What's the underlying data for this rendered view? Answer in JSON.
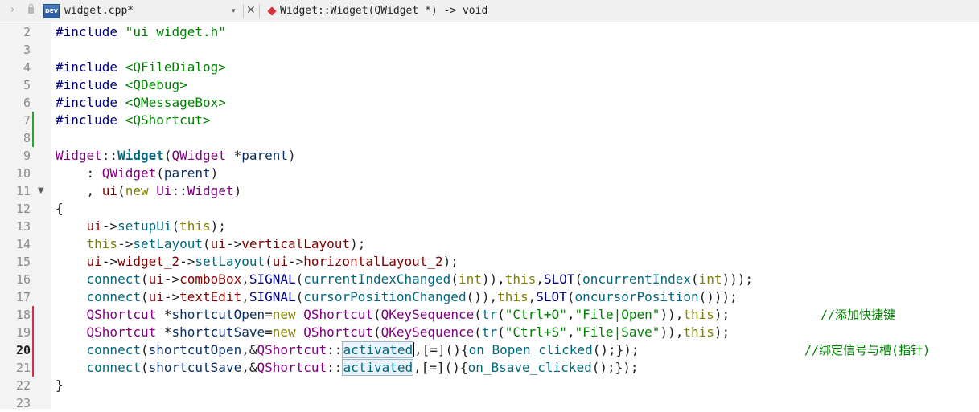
{
  "tabbar": {
    "back_arrow": "›",
    "file_icon_text": "DEV",
    "file_name": "widget.cpp*",
    "dropdown_arrow": "▾",
    "close": "✕",
    "symbol": "Widget::Widget(QWidget *) -> void"
  },
  "colors": {
    "modified_marker": "#d4313c",
    "saved_marker": "#2fa02f",
    "comment": "#008000"
  },
  "editor": {
    "current_line": 20,
    "lines": [
      {
        "n": "2",
        "marker": "",
        "fold": false,
        "tokens": [
          {
            "t": "#include",
            "c": "dir"
          },
          {
            "t": " ",
            "c": ""
          },
          {
            "t": "\"ui_widget.h\"",
            "c": "str"
          }
        ],
        "comment": ""
      },
      {
        "n": "3",
        "marker": "",
        "fold": false,
        "tokens": [],
        "comment": ""
      },
      {
        "n": "4",
        "marker": "",
        "fold": false,
        "tokens": [
          {
            "t": "#include",
            "c": "dir"
          },
          {
            "t": " ",
            "c": ""
          },
          {
            "t": "<QFileDialog>",
            "c": "inc"
          }
        ],
        "comment": ""
      },
      {
        "n": "5",
        "marker": "",
        "fold": false,
        "tokens": [
          {
            "t": "#include",
            "c": "dir"
          },
          {
            "t": " ",
            "c": ""
          },
          {
            "t": "<QDebug>",
            "c": "inc"
          }
        ],
        "comment": ""
      },
      {
        "n": "6",
        "marker": "",
        "fold": false,
        "tokens": [
          {
            "t": "#include",
            "c": "dir"
          },
          {
            "t": " ",
            "c": ""
          },
          {
            "t": "<QMessageBox>",
            "c": "inc"
          }
        ],
        "comment": ""
      },
      {
        "n": "7",
        "marker": "saved",
        "fold": false,
        "tokens": [
          {
            "t": "#include",
            "c": "dir"
          },
          {
            "t": " ",
            "c": ""
          },
          {
            "t": "<QShortcut>",
            "c": "inc"
          }
        ],
        "comment": ""
      },
      {
        "n": "8",
        "marker": "saved",
        "fold": false,
        "tokens": [],
        "comment": ""
      },
      {
        "n": "9",
        "marker": "",
        "fold": false,
        "tokens": [
          {
            "t": "Widget",
            "c": "cls"
          },
          {
            "t": "::",
            "c": ""
          },
          {
            "t": "Widget",
            "c": "fnb"
          },
          {
            "t": "(",
            "c": ""
          },
          {
            "t": "QWidget",
            "c": "cls"
          },
          {
            "t": " *",
            "c": ""
          },
          {
            "t": "parent",
            "c": "var"
          },
          {
            "t": ")",
            "c": ""
          }
        ],
        "comment": ""
      },
      {
        "n": "10",
        "marker": "",
        "fold": false,
        "tokens": [
          {
            "t": "    : ",
            "c": ""
          },
          {
            "t": "QWidget",
            "c": "cls"
          },
          {
            "t": "(",
            "c": ""
          },
          {
            "t": "parent",
            "c": "var"
          },
          {
            "t": ")",
            "c": ""
          }
        ],
        "comment": ""
      },
      {
        "n": "11",
        "marker": "",
        "fold": true,
        "tokens": [
          {
            "t": "    , ",
            "c": ""
          },
          {
            "t": "ui",
            "c": "mem"
          },
          {
            "t": "(",
            "c": ""
          },
          {
            "t": "new",
            "c": "kw"
          },
          {
            "t": " ",
            "c": ""
          },
          {
            "t": "Ui",
            "c": "cls"
          },
          {
            "t": "::",
            "c": ""
          },
          {
            "t": "Widget",
            "c": "cls"
          },
          {
            "t": ")",
            "c": ""
          }
        ],
        "comment": ""
      },
      {
        "n": "12",
        "marker": "",
        "fold": false,
        "tokens": [
          {
            "t": "{",
            "c": ""
          }
        ],
        "comment": ""
      },
      {
        "n": "13",
        "marker": "",
        "fold": false,
        "tokens": [
          {
            "t": "    ",
            "c": ""
          },
          {
            "t": "ui",
            "c": "mem"
          },
          {
            "t": "->",
            "c": ""
          },
          {
            "t": "setupUi",
            "c": "fn"
          },
          {
            "t": "(",
            "c": ""
          },
          {
            "t": "this",
            "c": "kw"
          },
          {
            "t": ");",
            "c": ""
          }
        ],
        "comment": ""
      },
      {
        "n": "14",
        "marker": "",
        "fold": false,
        "tokens": [
          {
            "t": "    ",
            "c": ""
          },
          {
            "t": "this",
            "c": "kw"
          },
          {
            "t": "->",
            "c": ""
          },
          {
            "t": "setLayout",
            "c": "fn"
          },
          {
            "t": "(",
            "c": ""
          },
          {
            "t": "ui",
            "c": "mem"
          },
          {
            "t": "->",
            "c": ""
          },
          {
            "t": "verticalLayout",
            "c": "mem"
          },
          {
            "t": ");",
            "c": ""
          }
        ],
        "comment": ""
      },
      {
        "n": "15",
        "marker": "",
        "fold": false,
        "tokens": [
          {
            "t": "    ",
            "c": ""
          },
          {
            "t": "ui",
            "c": "mem"
          },
          {
            "t": "->",
            "c": ""
          },
          {
            "t": "widget_2",
            "c": "mem"
          },
          {
            "t": "->",
            "c": ""
          },
          {
            "t": "setLayout",
            "c": "fn"
          },
          {
            "t": "(",
            "c": ""
          },
          {
            "t": "ui",
            "c": "mem"
          },
          {
            "t": "->",
            "c": ""
          },
          {
            "t": "horizontalLayout_2",
            "c": "mem"
          },
          {
            "t": ");",
            "c": ""
          }
        ],
        "comment": ""
      },
      {
        "n": "16",
        "marker": "",
        "fold": false,
        "tokens": [
          {
            "t": "    ",
            "c": ""
          },
          {
            "t": "connect",
            "c": "fn"
          },
          {
            "t": "(",
            "c": ""
          },
          {
            "t": "ui",
            "c": "mem"
          },
          {
            "t": "->",
            "c": ""
          },
          {
            "t": "comboBox",
            "c": "mem"
          },
          {
            "t": ",",
            "c": ""
          },
          {
            "t": "SIGNAL",
            "c": "dir"
          },
          {
            "t": "(",
            "c": ""
          },
          {
            "t": "currentIndexChanged",
            "c": "fn"
          },
          {
            "t": "(",
            "c": ""
          },
          {
            "t": "int",
            "c": "kw"
          },
          {
            "t": ")),",
            "c": ""
          },
          {
            "t": "this",
            "c": "kw"
          },
          {
            "t": ",",
            "c": ""
          },
          {
            "t": "SLOT",
            "c": "dir"
          },
          {
            "t": "(",
            "c": ""
          },
          {
            "t": "oncurrentIndex",
            "c": "fn"
          },
          {
            "t": "(",
            "c": ""
          },
          {
            "t": "int",
            "c": "kw"
          },
          {
            "t": ")));",
            "c": ""
          }
        ],
        "comment": ""
      },
      {
        "n": "17",
        "marker": "",
        "fold": false,
        "tokens": [
          {
            "t": "    ",
            "c": ""
          },
          {
            "t": "connect",
            "c": "fn"
          },
          {
            "t": "(",
            "c": ""
          },
          {
            "t": "ui",
            "c": "mem"
          },
          {
            "t": "->",
            "c": ""
          },
          {
            "t": "textEdit",
            "c": "mem"
          },
          {
            "t": ",",
            "c": ""
          },
          {
            "t": "SIGNAL",
            "c": "dir"
          },
          {
            "t": "(",
            "c": ""
          },
          {
            "t": "cursorPositionChanged",
            "c": "fn"
          },
          {
            "t": "()),",
            "c": ""
          },
          {
            "t": "this",
            "c": "kw"
          },
          {
            "t": ",",
            "c": ""
          },
          {
            "t": "SLOT",
            "c": "dir"
          },
          {
            "t": "(",
            "c": ""
          },
          {
            "t": "oncursorPosition",
            "c": "fn"
          },
          {
            "t": "()));",
            "c": ""
          }
        ],
        "comment": ""
      },
      {
        "n": "18",
        "marker": "modified",
        "fold": false,
        "tokens": [
          {
            "t": "    ",
            "c": ""
          },
          {
            "t": "QShortcut",
            "c": "cls"
          },
          {
            "t": " *",
            "c": ""
          },
          {
            "t": "shortcutOpen",
            "c": "var"
          },
          {
            "t": "=",
            "c": ""
          },
          {
            "t": "new",
            "c": "kw"
          },
          {
            "t": " ",
            "c": ""
          },
          {
            "t": "QShortcut",
            "c": "cls"
          },
          {
            "t": "(",
            "c": ""
          },
          {
            "t": "QKeySequence",
            "c": "cls"
          },
          {
            "t": "(",
            "c": ""
          },
          {
            "t": "tr",
            "c": "fn"
          },
          {
            "t": "(",
            "c": ""
          },
          {
            "t": "\"Ctrl+O\"",
            "c": "str"
          },
          {
            "t": ",",
            "c": ""
          },
          {
            "t": "\"File|Open\"",
            "c": "str"
          },
          {
            "t": ")),",
            "c": ""
          },
          {
            "t": "this",
            "c": "kw"
          },
          {
            "t": ");",
            "c": ""
          }
        ],
        "comment": "//添加快捷键",
        "comment_col": 1020
      },
      {
        "n": "19",
        "marker": "modified",
        "fold": false,
        "tokens": [
          {
            "t": "    ",
            "c": ""
          },
          {
            "t": "QShortcut",
            "c": "cls"
          },
          {
            "t": " *",
            "c": ""
          },
          {
            "t": "shortcutSave",
            "c": "var"
          },
          {
            "t": "=",
            "c": ""
          },
          {
            "t": "new",
            "c": "kw"
          },
          {
            "t": " ",
            "c": ""
          },
          {
            "t": "QShortcut",
            "c": "cls"
          },
          {
            "t": "(",
            "c": ""
          },
          {
            "t": "QKeySequence",
            "c": "cls"
          },
          {
            "t": "(",
            "c": ""
          },
          {
            "t": "tr",
            "c": "fn"
          },
          {
            "t": "(",
            "c": ""
          },
          {
            "t": "\"Ctrl+S\"",
            "c": "str"
          },
          {
            "t": ",",
            "c": ""
          },
          {
            "t": "\"File|Save\"",
            "c": "str"
          },
          {
            "t": ")),",
            "c": ""
          },
          {
            "t": "this",
            "c": "kw"
          },
          {
            "t": ");",
            "c": ""
          }
        ],
        "comment": ""
      },
      {
        "n": "20",
        "marker": "modified",
        "fold": false,
        "tokens": [
          {
            "t": "    ",
            "c": ""
          },
          {
            "t": "connect",
            "c": "fn"
          },
          {
            "t": "(",
            "c": ""
          },
          {
            "t": "shortcutOpen",
            "c": "var"
          },
          {
            "t": ",&",
            "c": ""
          },
          {
            "t": "QShortcut",
            "c": "cls"
          },
          {
            "t": "::",
            "c": ""
          },
          {
            "t": "activated",
            "c": "hl",
            "cursor": true
          },
          {
            "t": ",[=](){",
            "c": ""
          },
          {
            "t": "on_Bopen_clicked",
            "c": "fn"
          },
          {
            "t": "();});",
            "c": ""
          }
        ],
        "comment": "//绑定信号与槽(指针)",
        "comment_col": 1000
      },
      {
        "n": "21",
        "marker": "modified",
        "fold": false,
        "tokens": [
          {
            "t": "    ",
            "c": ""
          },
          {
            "t": "connect",
            "c": "fn"
          },
          {
            "t": "(",
            "c": ""
          },
          {
            "t": "shortcutSave",
            "c": "var"
          },
          {
            "t": ",&",
            "c": ""
          },
          {
            "t": "QShortcut",
            "c": "cls"
          },
          {
            "t": "::",
            "c": ""
          },
          {
            "t": "activated",
            "c": "hl"
          },
          {
            "t": ",[=](){",
            "c": ""
          },
          {
            "t": "on_Bsave_clicked",
            "c": "fn"
          },
          {
            "t": "();});",
            "c": ""
          }
        ],
        "comment": ""
      },
      {
        "n": "22",
        "marker": "",
        "fold": false,
        "tokens": [
          {
            "t": "}",
            "c": ""
          }
        ],
        "comment": ""
      },
      {
        "n": "23",
        "marker": "",
        "fold": false,
        "tokens": [],
        "comment": ""
      }
    ]
  }
}
